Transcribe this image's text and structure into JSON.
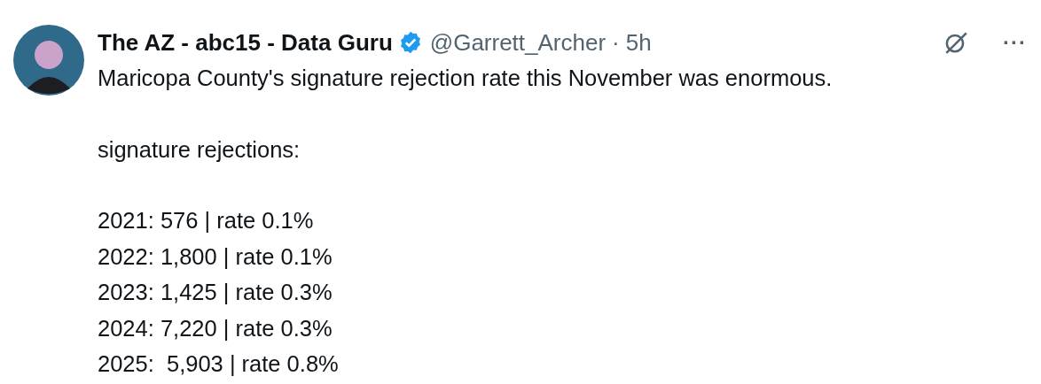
{
  "post": {
    "author": {
      "name": "The AZ - abc15 - Data Guru",
      "verified": true,
      "handle": "@Garrett_Archer",
      "separator": "·",
      "time": "5h"
    },
    "paragraphs": [
      "Maricopa County's signature rejection rate this November was enormous.",
      "signature rejections:",
      "2021: 576 | rate 0.1%\n2022: 1,800 | rate 0.1%\n2023: 1,425 | rate 0.3%\n2024: 7,220 | rate 0.3%\n2025:  5,903 | rate 0.8%"
    ],
    "more_button": "···"
  }
}
